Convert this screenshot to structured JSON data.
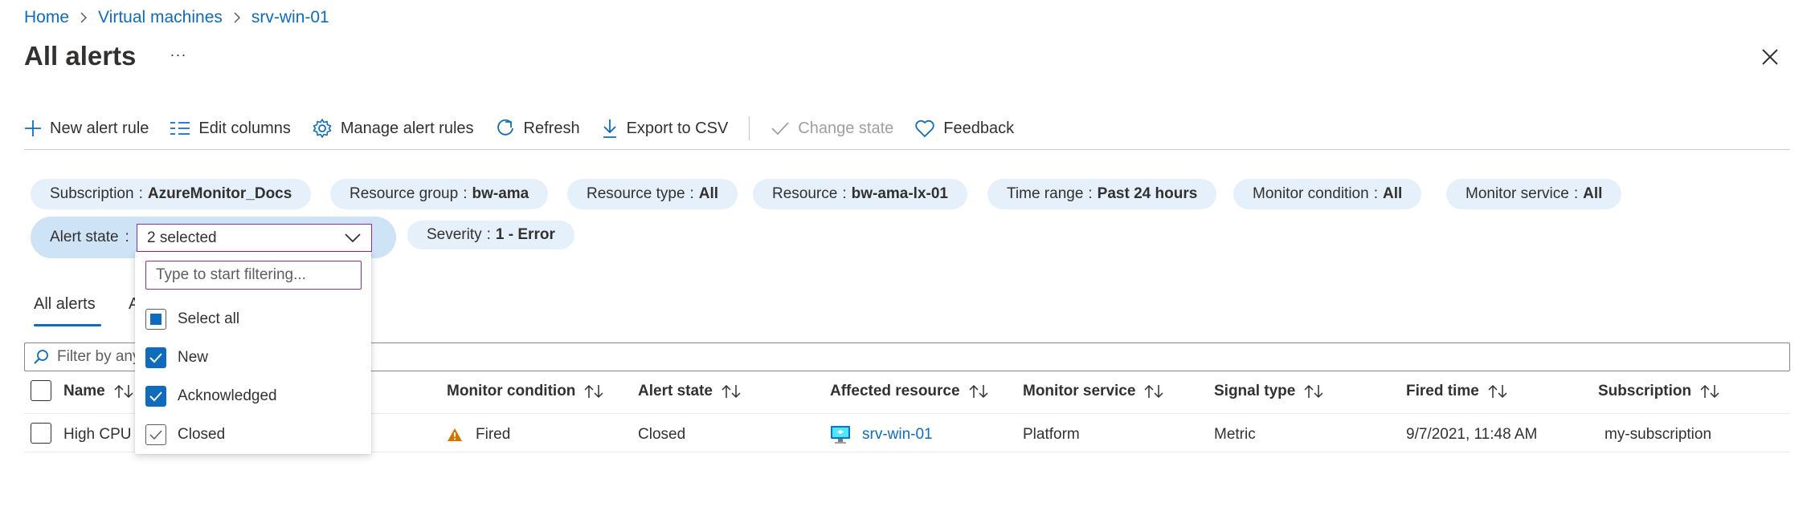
{
  "breadcrumb": [
    {
      "label": "Home"
    },
    {
      "label": "Virtual machines"
    },
    {
      "label": "srv-win-01"
    }
  ],
  "page": {
    "title": "All alerts",
    "more": "···"
  },
  "toolbar": {
    "new_alert_rule": "New alert rule",
    "edit_columns": "Edit columns",
    "manage_alert_rules": "Manage alert rules",
    "refresh": "Refresh",
    "export_csv": "Export to CSV",
    "change_state": "Change state",
    "feedback": "Feedback"
  },
  "filters": {
    "sep": ":",
    "subscription": {
      "label": "Subscription",
      "value": "AzureMonitor_Docs"
    },
    "resource_group": {
      "label": "Resource group",
      "value": "bw-ama"
    },
    "resource_type": {
      "label": "Resource type",
      "value": "All"
    },
    "resource": {
      "label": "Resource",
      "value": "bw-ama-lx-01"
    },
    "time_range": {
      "label": "Time range",
      "value": "Past 24 hours"
    },
    "monitor_condition": {
      "label": "Monitor condition",
      "value": "All"
    },
    "monitor_service": {
      "label": "Monitor service",
      "value": "All"
    },
    "alert_state": {
      "label": "Alert state",
      "value": "2 selected"
    },
    "severity": {
      "label": "Severity",
      "value": "1 - Error"
    }
  },
  "dropdown": {
    "search_placeholder": "Type to start filtering...",
    "items": [
      {
        "label": "Select all",
        "state": "partial"
      },
      {
        "label": "New",
        "state": "checked"
      },
      {
        "label": "Acknowledged",
        "state": "checked"
      },
      {
        "label": "Closed",
        "state": "unchecked"
      }
    ]
  },
  "tabs": [
    {
      "label": "All alerts",
      "active": true
    },
    {
      "label": "A",
      "active": false
    }
  ],
  "grid": {
    "filter_placeholder": "Filter by any",
    "columns": {
      "name": "Name",
      "monitor_condition": "Monitor condition",
      "alert_state": "Alert state",
      "affected_resource": "Affected resource",
      "monitor_service": "Monitor service",
      "signal_type": "Signal type",
      "fired_time": "Fired time",
      "subscription": "Subscription"
    },
    "rows": [
      {
        "name": "High CPU",
        "monitor_condition": "Fired",
        "alert_state": "Closed",
        "affected_resource": "srv-win-01",
        "monitor_service": "Platform",
        "signal_type": "Metric",
        "fired_time": "9/7/2021, 11:48 AM",
        "subscription": "my-subscription"
      }
    ]
  },
  "colors": {
    "link": "#0f6cbd",
    "pill_bg": "#e5f0fb",
    "warning": "#d47500",
    "focus_border": "#8a2da5"
  },
  "icons": {
    "add": "plus-icon",
    "columns": "edit-columns-icon",
    "gear": "gear-icon",
    "refresh": "refresh-icon",
    "download": "download-icon",
    "check": "checkmark-icon",
    "heart": "heart-icon",
    "close": "close-icon",
    "search": "search-icon",
    "sort": "sort-icon",
    "warning": "warning-icon",
    "vm": "virtual-machine-icon"
  }
}
